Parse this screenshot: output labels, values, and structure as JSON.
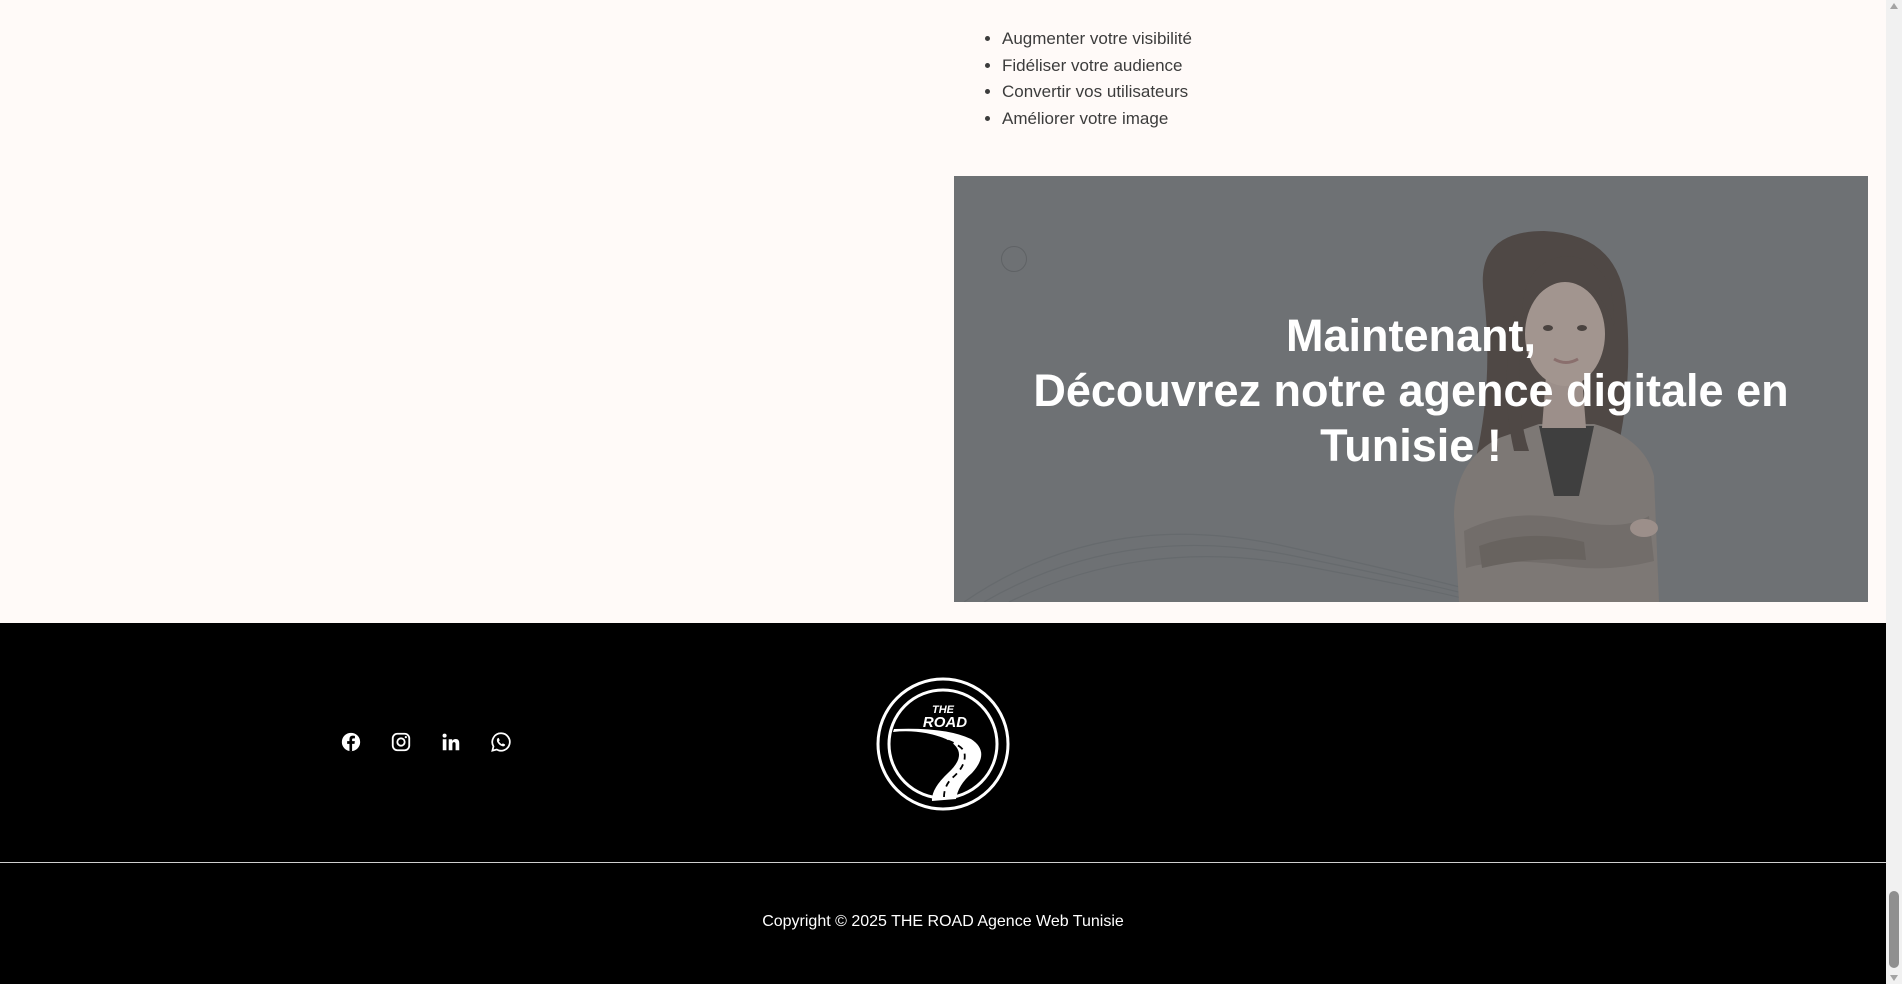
{
  "benefits": {
    "items": [
      "Augmenter votre visibilité",
      "Fidéliser votre audience",
      "Convertir vos utilisateurs",
      "Améliorer votre image"
    ]
  },
  "banner": {
    "headline_line1": "Maintenant,",
    "headline_line2": "Découvrez notre agence digitale en",
    "headline_line3": "Tunisie !",
    "overlay_color": "#6e7174"
  },
  "footer": {
    "social_icons": [
      "facebook-icon",
      "instagram-icon",
      "linkedin-icon",
      "whatsapp-icon"
    ],
    "logo_text_top": "THE",
    "logo_text_bottom": "ROAD",
    "copyright": "Copyright © 2025 THE ROAD Agence Web Tunisie",
    "background_color": "#000000"
  },
  "scrollbar": {
    "position": 0.96
  }
}
